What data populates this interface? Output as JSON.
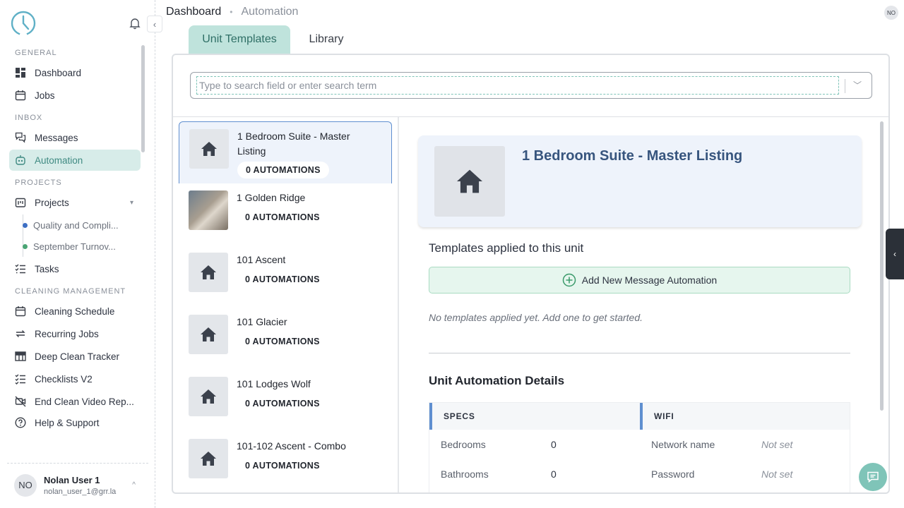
{
  "sidebar": {
    "sections": {
      "general": "GENERAL",
      "inbox": "INBOX",
      "projects": "PROJECTS",
      "cleaning": "CLEANING MANAGEMENT"
    },
    "items": {
      "dashboard": "Dashboard",
      "jobs": "Jobs",
      "messages": "Messages",
      "automation": "Automation",
      "projects": "Projects",
      "project_1": "Quality and Compli...",
      "project_2": "September Turnov...",
      "tasks": "Tasks",
      "cleaning_schedule": "Cleaning Schedule",
      "recurring_jobs": "Recurring Jobs",
      "deep_clean": "Deep Clean Tracker",
      "checklists": "Checklists V2",
      "end_clean": "End Clean Video Rep...",
      "help": "Help & Support"
    },
    "project_dot_colors": [
      "#3d6fc4",
      "#4aa574"
    ],
    "user": {
      "initials": "NO",
      "name": "Nolan User 1",
      "email": "nolan_user_1@grr.la"
    }
  },
  "header": {
    "crumb_1": "Dashboard",
    "crumb_sep": "•",
    "crumb_2": "Automation",
    "avatar_initials": "NO"
  },
  "tabs": {
    "unit_templates": "Unit Templates",
    "library": "Library"
  },
  "search": {
    "placeholder": "Type to search field or enter search term"
  },
  "units": [
    {
      "name": "1 Bedroom Suite - Master Listing",
      "badge": "0 AUTOMATIONS"
    },
    {
      "name": "1 Golden Ridge",
      "badge": "0 AUTOMATIONS"
    },
    {
      "name": "101 Ascent",
      "badge": "0 AUTOMATIONS"
    },
    {
      "name": "101 Glacier",
      "badge": "0 AUTOMATIONS"
    },
    {
      "name": "101 Lodges Wolf",
      "badge": "0 AUTOMATIONS"
    },
    {
      "name": "101-102 Ascent - Combo",
      "badge": "0 AUTOMATIONS"
    }
  ],
  "detail": {
    "title": "1 Bedroom Suite - Master Listing",
    "templates_heading": "Templates applied to this unit",
    "add_button": "Add New Message Automation",
    "empty_text": "No templates applied yet. Add one to get started.",
    "details_heading": "Unit Automation Details",
    "specs_header": "SPECS",
    "wifi_header": "WIFI",
    "specs": [
      {
        "label": "Bedrooms",
        "value": "0"
      },
      {
        "label": "Bathrooms",
        "value": "0"
      }
    ],
    "wifi": [
      {
        "label": "Network name",
        "value": "Not set"
      },
      {
        "label": "Password",
        "value": "Not set"
      }
    ]
  },
  "colors": {
    "accent": "#7fc4b8",
    "active_nav_bg": "#d7ece9",
    "selected_border": "#5f8fd0",
    "title_blue": "#37557e"
  }
}
